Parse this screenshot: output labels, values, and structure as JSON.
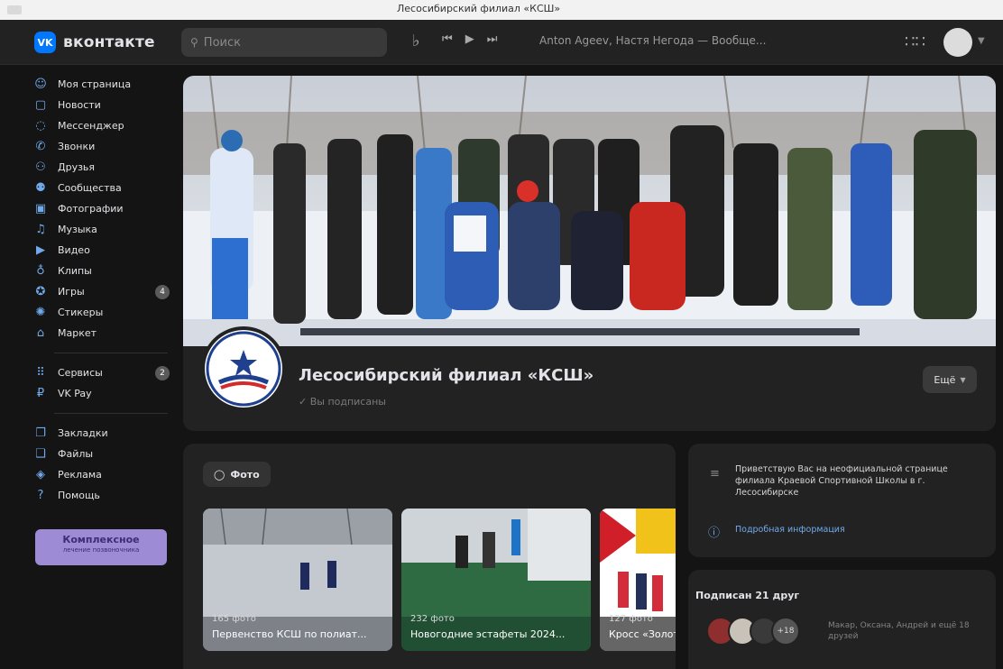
{
  "browser": {
    "tab_title": "Лесосибирский филиал «КСШ»"
  },
  "header": {
    "logo_mark": "VK",
    "logo_text": "вконтакте",
    "search_placeholder": "Поиск",
    "track": "Anton Ageev, Настя Негода — Вообще..."
  },
  "sidebar": {
    "items": [
      {
        "label": "Моя страница",
        "icon": "user-icon",
        "glyph": "☺"
      },
      {
        "label": "Новости",
        "icon": "news-icon",
        "glyph": "▢"
      },
      {
        "label": "Мессенджер",
        "icon": "chat-icon",
        "glyph": "◌"
      },
      {
        "label": "Звонки",
        "icon": "phone-icon",
        "glyph": "✆"
      },
      {
        "label": "Друзья",
        "icon": "friends-icon",
        "glyph": "⚇"
      },
      {
        "label": "Сообщества",
        "icon": "community-icon",
        "glyph": "⚉"
      },
      {
        "label": "Фотографии",
        "icon": "photo-icon",
        "glyph": "▣"
      },
      {
        "label": "Музыка",
        "icon": "music-icon",
        "glyph": "♫"
      },
      {
        "label": "Видео",
        "icon": "video-icon",
        "glyph": "▶"
      },
      {
        "label": "Клипы",
        "icon": "clips-icon",
        "glyph": "♁"
      },
      {
        "label": "Игры",
        "icon": "games-icon",
        "glyph": "✪",
        "badge": "4"
      },
      {
        "label": "Стикеры",
        "icon": "stickers-icon",
        "glyph": "✺"
      },
      {
        "label": "Маркет",
        "icon": "market-icon",
        "glyph": "⌂"
      }
    ],
    "items2": [
      {
        "label": "Сервисы",
        "icon": "services-icon",
        "glyph": "⠿",
        "badge": "2"
      },
      {
        "label": "VK Pay",
        "icon": "vkpay-icon",
        "glyph": "₽"
      }
    ],
    "items3": [
      {
        "label": "Закладки",
        "icon": "bookmark-icon",
        "glyph": "❐"
      },
      {
        "label": "Файлы",
        "icon": "files-icon",
        "glyph": "❑"
      },
      {
        "label": "Реклама",
        "icon": "ads-icon",
        "glyph": "◈"
      },
      {
        "label": "Помощь",
        "icon": "help-icon",
        "glyph": "?"
      }
    ],
    "promo_title": "Комплексное",
    "promo_sub": "лечение позвоночника"
  },
  "community": {
    "name": "Лесосибирский филиал «КСШ»",
    "subscribed": "✓ Вы подписаны",
    "more_label": "Ещё"
  },
  "photos": {
    "tab_label": "Фото",
    "albums": [
      {
        "count": "165 фото",
        "title": "Первенство КСШ по полиат..."
      },
      {
        "count": "232 фото",
        "title": "Новогодние эстафеты 2024..."
      },
      {
        "count": "127 фото",
        "title": "Кросс «Золотая..."
      }
    ]
  },
  "info": {
    "text": "Приветствую Вас на неофициальной странице филиала Краевой Спортивной Школы в г. Лесосибирске",
    "link": "Подробная информация"
  },
  "friends": {
    "title": "Подписан 21 друг",
    "more": "+18",
    "text": "Макар, Оксана, Андрей и ещё 18 друзей"
  }
}
